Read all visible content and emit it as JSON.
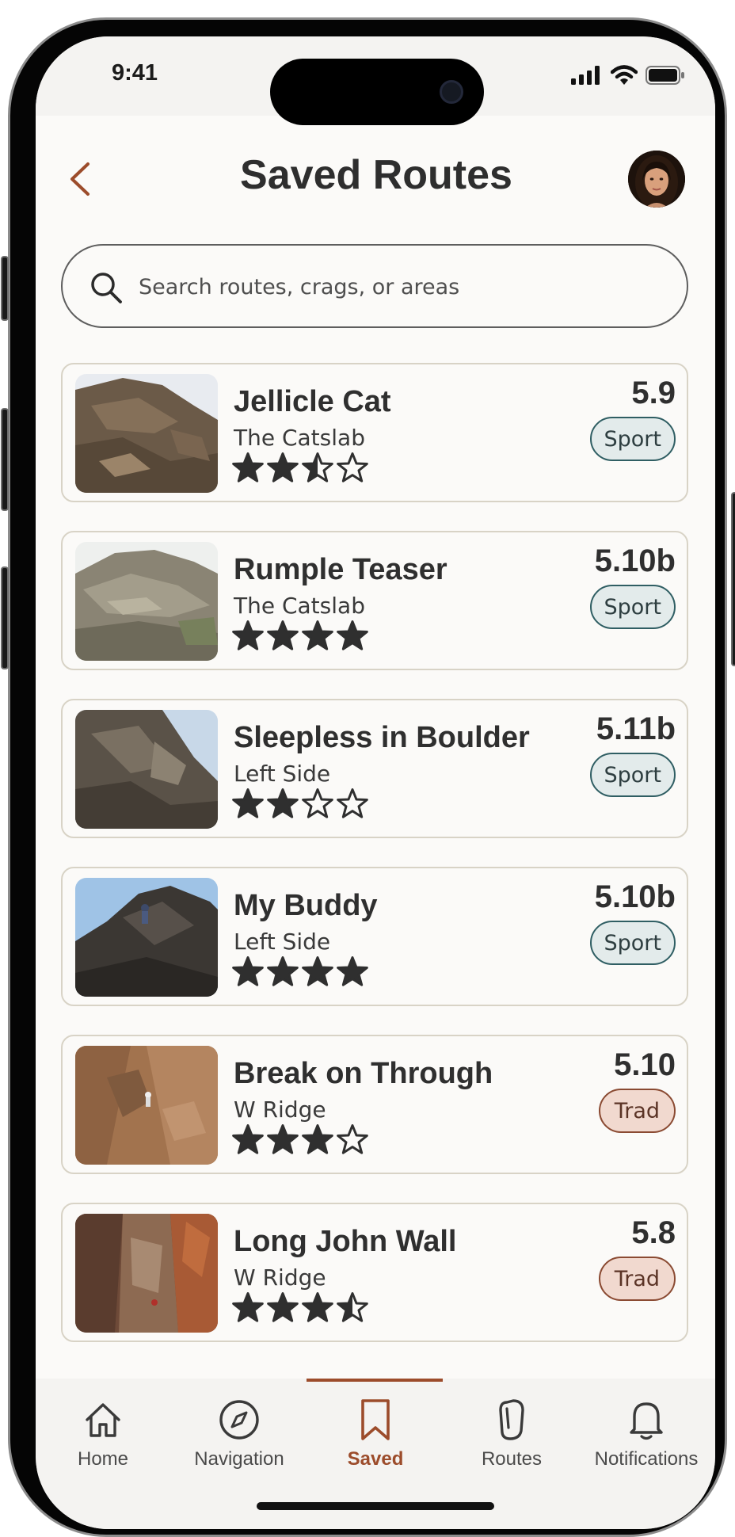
{
  "status_bar": {
    "time": "9:41"
  },
  "header": {
    "title": "Saved Routes"
  },
  "search": {
    "placeholder": "Search routes, crags, or areas"
  },
  "routes": [
    {
      "name": "Jellicle Cat",
      "crag": "The Catslab",
      "grade": "5.9",
      "type": "Sport",
      "rating": 2.5
    },
    {
      "name": "Rumple Teaser",
      "crag": "The Catslab",
      "grade": "5.10b",
      "type": "Sport",
      "rating": 4
    },
    {
      "name": "Sleepless in Boulder",
      "crag": "Left Side",
      "grade": "5.11b",
      "type": "Sport",
      "rating": 2
    },
    {
      "name": "My Buddy",
      "crag": "Left Side",
      "grade": "5.10b",
      "type": "Sport",
      "rating": 4
    },
    {
      "name": "Break on Through",
      "crag": "W Ridge",
      "grade": "5.10",
      "type": "Trad",
      "rating": 3
    },
    {
      "name": "Long John Wall",
      "crag": "W Ridge",
      "grade": "5.8",
      "type": "Trad",
      "rating": 3.5
    }
  ],
  "tabs": [
    {
      "label": "Home",
      "icon": "home-icon"
    },
    {
      "label": "Navigation",
      "icon": "compass-icon"
    },
    {
      "label": "Saved",
      "icon": "bookmark-icon",
      "active": true
    },
    {
      "label": "Routes",
      "icon": "carabiner-icon"
    },
    {
      "label": "Notifications",
      "icon": "bell-icon"
    }
  ],
  "colors": {
    "accent": "#9c4c2b",
    "sport_badge_bg": "#e3ebeb",
    "sport_badge_border": "#2f5e63",
    "trad_badge_bg": "#f1d9cf",
    "trad_badge_border": "#8a4a32",
    "star": "#2f2f2f"
  }
}
